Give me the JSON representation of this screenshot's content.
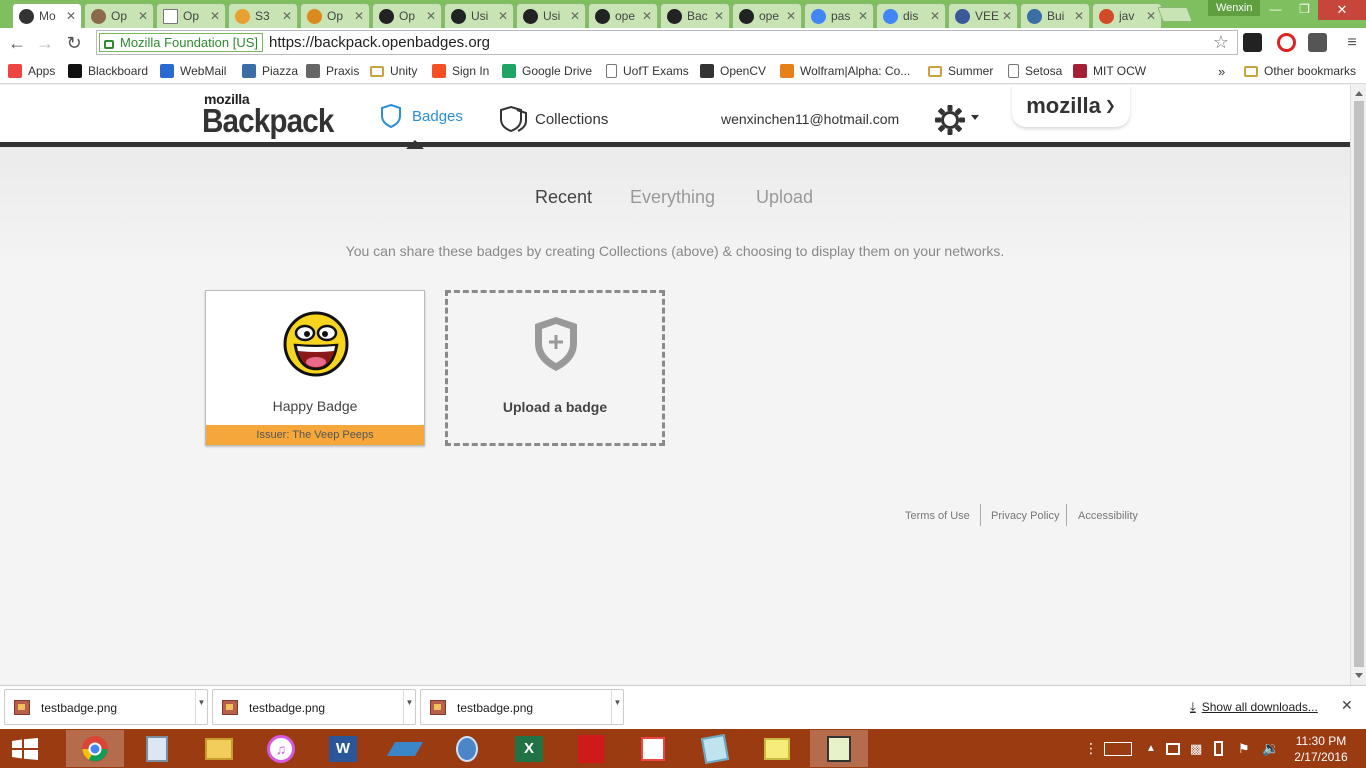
{
  "browser": {
    "tabs": [
      {
        "label": "Mo",
        "icon": "backpack-shield-icon",
        "active": true
      },
      {
        "label": "Op",
        "icon": "avatar-photo-icon",
        "active": false
      },
      {
        "label": "Op",
        "icon": "page-icon",
        "active": false
      },
      {
        "label": "S3",
        "icon": "s3-box-icon",
        "active": false
      },
      {
        "label": "Op",
        "icon": "ring-icon",
        "active": false
      },
      {
        "label": "Op",
        "icon": "github-icon",
        "active": false
      },
      {
        "label": "Usi",
        "icon": "github-icon",
        "active": false
      },
      {
        "label": "Usi",
        "icon": "github-icon",
        "active": false
      },
      {
        "label": "ope",
        "icon": "github-icon",
        "active": false
      },
      {
        "label": "Bac",
        "icon": "github-icon",
        "active": false
      },
      {
        "label": "ope",
        "icon": "github-icon",
        "active": false
      },
      {
        "label": "pas",
        "icon": "google-icon",
        "active": false
      },
      {
        "label": "dis",
        "icon": "google-icon",
        "active": false
      },
      {
        "label": "VEE",
        "icon": "facebook-icon",
        "active": false
      },
      {
        "label": "Bui",
        "icon": "c-icon",
        "active": false
      },
      {
        "label": "jav",
        "icon": "java-icon",
        "active": false
      }
    ],
    "profile_name": "Wenxin",
    "omnibox": {
      "ev_label": "Mozilla Foundation [US]",
      "url": "https://backpack.openbadges.org"
    },
    "bookmarks": [
      {
        "label": "Apps",
        "icon": "apps-grid-icon"
      },
      {
        "label": "Blackboard",
        "icon": "blackboard-icon"
      },
      {
        "label": "WebMail",
        "icon": "mail-icon"
      },
      {
        "label": "Piazza",
        "icon": "piazza-icon"
      },
      {
        "label": "Praxis",
        "icon": "praxis-icon"
      },
      {
        "label": "Unity",
        "icon": "folder-icon"
      },
      {
        "label": "Sign In",
        "icon": "windows-icon"
      },
      {
        "label": "Google Drive",
        "icon": "drive-icon"
      },
      {
        "label": "UofT Exams",
        "icon": "page-icon"
      },
      {
        "label": "OpenCV",
        "icon": "film-icon"
      },
      {
        "label": "Wolfram|Alpha: Co...",
        "icon": "wolfram-icon"
      },
      {
        "label": "Summer",
        "icon": "folder-icon"
      },
      {
        "label": "Setosa",
        "icon": "page-icon"
      },
      {
        "label": "MIT OCW",
        "icon": "mit-icon"
      }
    ],
    "bookmarks_overflow": "»",
    "other_bookmarks": "Other bookmarks"
  },
  "site": {
    "logo_small": "mozilla",
    "logo_big": "Backpack",
    "nav": {
      "badges": "Badges",
      "collections": "Collections"
    },
    "user_email": "wenxinchen11@hotmail.com",
    "mozilla_tab": "mozilla"
  },
  "subtabs": [
    "Recent",
    "Everything",
    "Upload"
  ],
  "share_message": "You can share these badges by creating Collections (above) & choosing to display them on your networks.",
  "badge": {
    "name": "Happy Badge",
    "issuer": "Issuer: The Veep Peeps"
  },
  "upload": {
    "label": "Upload a badge"
  },
  "footer": [
    "Terms of Use",
    "Privacy Policy",
    "Accessibility"
  ],
  "downloads": {
    "items": [
      "testbadge.png",
      "testbadge.png",
      "testbadge.png"
    ],
    "show_all": "Show all downloads..."
  },
  "taskbar": {
    "time": "11:30 PM",
    "date": "2/17/2016"
  },
  "colors": {
    "accent": "#2a8fd8",
    "issuer_bar": "#f6a73a",
    "taskbar": "#9b3b12",
    "tabstrip": "#7fbf5f"
  }
}
